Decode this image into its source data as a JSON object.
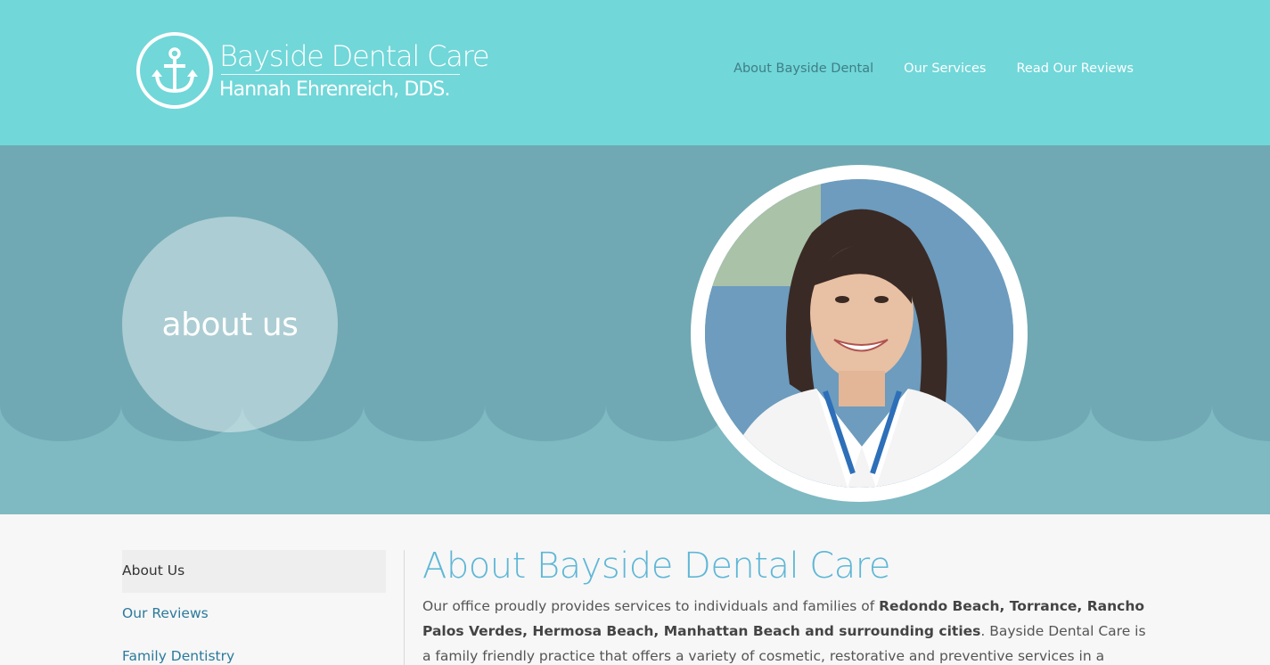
{
  "brand": {
    "title": "Bayside Dental Care",
    "subtitle": "Hannah Ehrenreich, DDS."
  },
  "nav": [
    {
      "label": "About Bayside Dental",
      "active": true
    },
    {
      "label": "Our Services",
      "active": false
    },
    {
      "label": "Read Our Reviews",
      "active": false
    }
  ],
  "hero": {
    "badge": "about us"
  },
  "sidebar": {
    "items": [
      {
        "label": "About Us",
        "active": true
      },
      {
        "label": "Our Reviews",
        "active": false
      },
      {
        "label": "Family Dentistry",
        "active": false
      }
    ]
  },
  "main": {
    "heading": "About Bayside Dental Care",
    "para_intro": "Our office proudly provides services to individuals and families of ",
    "para_cities": "Redondo Beach, Torrance, Rancho Palos Verdes, Hermosa Beach, Manhattan Beach and surrounding cities",
    "para_rest": ". Bayside Dental Care is a family friendly practice that offers a variety of cosmetic, restorative and preventive services in a modern, cozy and welcoming"
  },
  "colors": {
    "header_bg": "#71d7d9",
    "hero_bg": "#70a9b3",
    "wave": "#7fb9c2",
    "heading": "#5fb7d6",
    "link": "#2b7a9c"
  },
  "icons": {
    "logo": "anchor-icon"
  }
}
